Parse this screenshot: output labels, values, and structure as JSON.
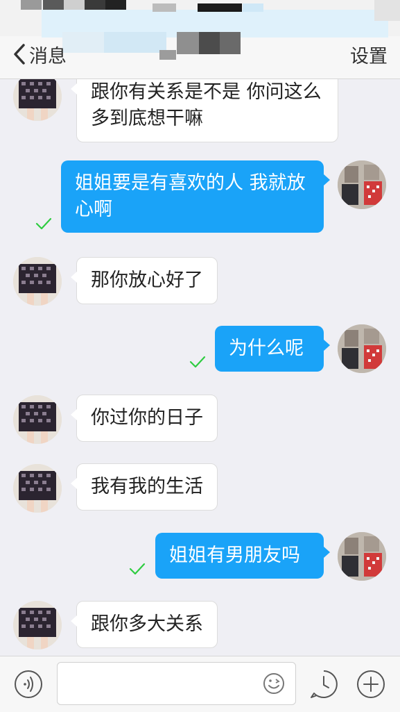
{
  "header": {
    "back_label": "消息",
    "settings_label": "设置"
  },
  "messages": [
    {
      "side": "in",
      "text": "跟你有关系是不是 你问这么多到底想干嘛",
      "read": false
    },
    {
      "side": "out",
      "text": "姐姐要是有喜欢的人 我就放心啊",
      "read": true
    },
    {
      "side": "in",
      "text": "那你放心好了",
      "read": false
    },
    {
      "side": "out",
      "text": "为什么呢",
      "read": true
    },
    {
      "side": "in",
      "text": "你过你的日子",
      "read": false
    },
    {
      "side": "in",
      "text": "我有我的生活",
      "read": false
    },
    {
      "side": "out",
      "text": "姐姐有男朋友吗",
      "read": true
    },
    {
      "side": "in",
      "text": "跟你多大关系",
      "read": false
    }
  ],
  "input": {
    "value": "",
    "placeholder": ""
  },
  "colors": {
    "outgoing_bubble": "#1aa3f8",
    "incoming_bubble": "#ffffff",
    "read_check": "#2ecc40",
    "background": "#efeff4"
  },
  "icons": {
    "voice": "voice-icon",
    "emoji": "emoji-icon",
    "clock": "clock-icon",
    "plus": "plus-icon",
    "back": "chevron-left-icon",
    "read": "check-icon"
  }
}
